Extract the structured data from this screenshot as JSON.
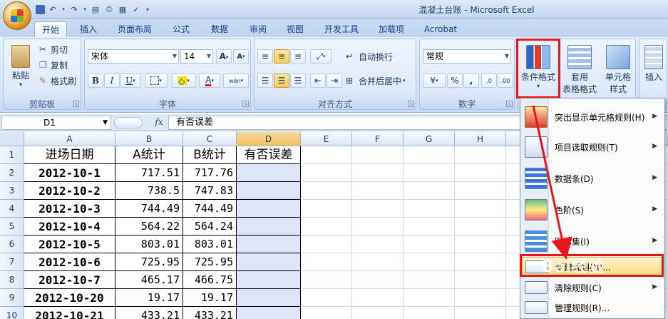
{
  "window": {
    "title": "混凝土台账 - Microsoft Excel"
  },
  "tabs": [
    "开始",
    "插入",
    "页面布局",
    "公式",
    "数据",
    "审阅",
    "视图",
    "开发工具",
    "加载项",
    "Acrobat"
  ],
  "ribbon": {
    "clipboard": {
      "paste": "粘贴",
      "cut": "剪切",
      "copy": "复制",
      "format_painter": "格式刷",
      "label": "剪贴板"
    },
    "font": {
      "name": "宋体",
      "size": "14",
      "label": "字体",
      "bold": "B",
      "italic": "I",
      "underline": "U",
      "grow": "A",
      "shrink": "A",
      "font_color": "A",
      "phonetic": "wén"
    },
    "alignment": {
      "wrap": "自动换行",
      "merge": "合并后居中",
      "label": "对齐方式"
    },
    "number": {
      "format": "常规",
      "percent": "%",
      "comma": ",",
      "label": "数字"
    },
    "styles": {
      "conditional": "条件格式",
      "table_format_1": "套用",
      "table_format_2": "表格格式",
      "cell_style_1": "单元格",
      "cell_style_2": "样式"
    },
    "cells": {
      "insert": "插入"
    }
  },
  "formula_bar": {
    "name_box": "D1",
    "fx": "fx",
    "content": "有否误差"
  },
  "columns": [
    "A",
    "B",
    "C",
    "D",
    "E",
    "F",
    "G",
    "H"
  ],
  "rows": [
    "1",
    "2",
    "3",
    "4",
    "5",
    "6",
    "7",
    "8",
    "9",
    "10"
  ],
  "sheet": {
    "headers": [
      "进场日期",
      "A统计",
      "B统计",
      "有否误差"
    ],
    "data": [
      [
        "2012-10-1",
        "717.51",
        "717.76"
      ],
      [
        "2012-10-2",
        "738.5",
        "747.83"
      ],
      [
        "2012-10-3",
        "744.49",
        "744.49"
      ],
      [
        "2012-10-4",
        "564.22",
        "564.24"
      ],
      [
        "2012-10-5",
        "803.01",
        "803.01"
      ],
      [
        "2012-10-6",
        "725.95",
        "725.95"
      ],
      [
        "2012-10-7",
        "465.17",
        "466.75"
      ],
      [
        "2012-10-20",
        "19.17",
        "19.17"
      ],
      [
        "2012-10-21",
        "433.21",
        "433.21"
      ]
    ]
  },
  "menu": {
    "items": [
      {
        "label": "突出显示单元格规则(H)",
        "icon": "highlight-cells-icon",
        "submenu": true
      },
      {
        "label": "项目选取规则(T)",
        "icon": "top-bottom-rules-icon",
        "submenu": true
      },
      {
        "label": "数据条(D)",
        "icon": "data-bars-icon",
        "submenu": true
      },
      {
        "label": "色阶(S)",
        "icon": "color-scales-icon",
        "submenu": true
      },
      {
        "label": "图标集(I)",
        "icon": "icon-sets-icon",
        "submenu": true
      },
      {
        "label": "新建规则(N)...",
        "icon": "new-rule-icon",
        "submenu": false
      },
      {
        "label": "清除规则(C)",
        "icon": "clear-rules-icon",
        "submenu": true
      },
      {
        "label": "管理规则(R)...",
        "icon": "manage-rules-icon",
        "submenu": false
      }
    ]
  },
  "watermark": "Bai经验",
  "colors": {
    "highlight_red": "#e8161a",
    "accent_blue": "#15428b"
  }
}
